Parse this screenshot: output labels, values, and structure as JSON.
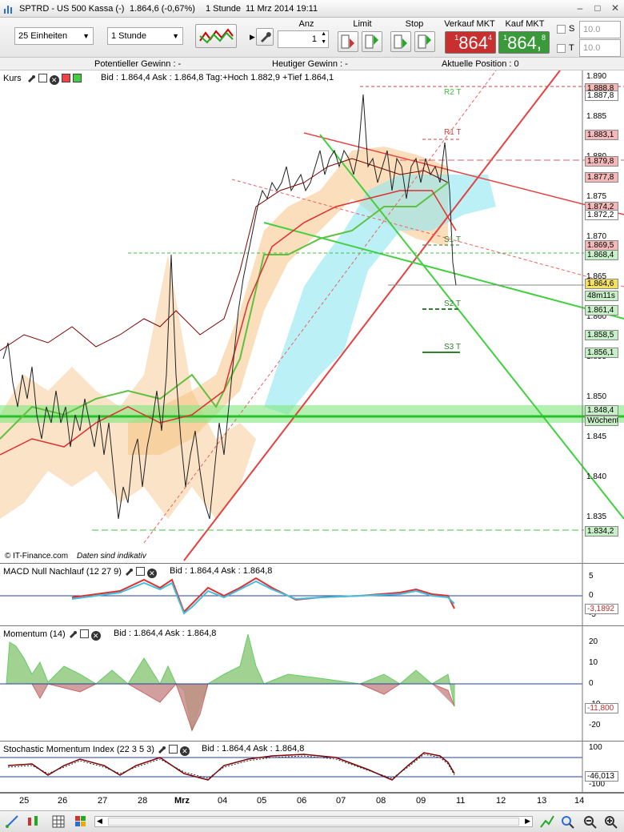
{
  "window": {
    "title": "SPTRD - US 500 Kassa (-)",
    "price": "1.864,6 (-0,67%)",
    "interval": "1 Stunde",
    "datetime": "11 Mrz 2014 19:11",
    "accent": "#2a6fd6"
  },
  "toolbar": {
    "units": "25 Einheiten",
    "timeframe": "1 Stunde",
    "qty_label": "Anz",
    "qty_value": "1",
    "limit_label": "Limit",
    "stop_label": "Stop",
    "sell_label": "Verkauf MKT",
    "buy_label": "Kauf MKT",
    "sell_prefix": "1",
    "sell_price": "864",
    "sell_sup": "4",
    "buy_prefix": "1",
    "buy_price": "864,",
    "buy_sup": "8",
    "s_label": "S",
    "t_label": "T",
    "s_value": "10.0",
    "t_value": "10.0",
    "sell_color": "#c83030",
    "buy_color": "#3a9a3a"
  },
  "infobar": {
    "potential": "Potentieller Gewinn : -",
    "today": "Heutiger Gewinn : -",
    "position": "Aktuelle Position : 0"
  },
  "main": {
    "name": "Kurs",
    "bidtext": "Bid : 1.864,4 Ask : 1.864,8 Tag:+Hoch 1.882,9 +Tief 1.864,1",
    "watermark1": "© IT-Finance.com",
    "watermark2": "Daten sind indikativ",
    "axis": [
      "1.890",
      "1.885",
      "1.880",
      "1.875",
      "1.870",
      "1.865",
      "1.860",
      "1.855",
      "1.850",
      "1.845",
      "1.840",
      "1.835"
    ],
    "tags": [
      "1.888,8",
      "1.887,8",
      "1.883,1",
      "1.879,8",
      "1.877,8",
      "1.874,2",
      "1.872,2",
      "1.869,5",
      "1.868,4",
      "1.864,6",
      "48m11s",
      "1.861,4",
      "1.858,5",
      "1.856,1",
      "1.848,4",
      "Wöchentli",
      "1.834,2"
    ],
    "pivots": {
      "r1": "R1 T",
      "s1": "S1 T",
      "s2": "S2 T",
      "s3": "S3 T",
      "r2": "R2 T"
    }
  },
  "macd": {
    "name": "MACD Null Nachlauf (12 27 9)",
    "bidtext": "Bid : 1.864,4 Ask : 1.864,8",
    "axis": [
      "5",
      "0",
      "-5"
    ],
    "tags": [
      "-3,1892"
    ]
  },
  "momentum": {
    "name": "Momentum (14)",
    "bidtext": "Bid : 1.864,4 Ask : 1.864,8",
    "axis": [
      "20",
      "10",
      "0",
      "-10",
      "-20"
    ],
    "tags": [
      "-11,800"
    ]
  },
  "smi": {
    "name": "Stochastic Momentum Index (22 3 5 3)",
    "bidtext": "Bid : 1.864,4 Ask : 1.864,8",
    "axis": [
      "100",
      "-100"
    ],
    "tags": [
      "-46,013"
    ]
  },
  "dates": [
    "25",
    "26",
    "27",
    "28",
    "Mrz",
    "04",
    "05",
    "06",
    "07",
    "08",
    "09",
    "11",
    "12",
    "13",
    "14"
  ]
}
